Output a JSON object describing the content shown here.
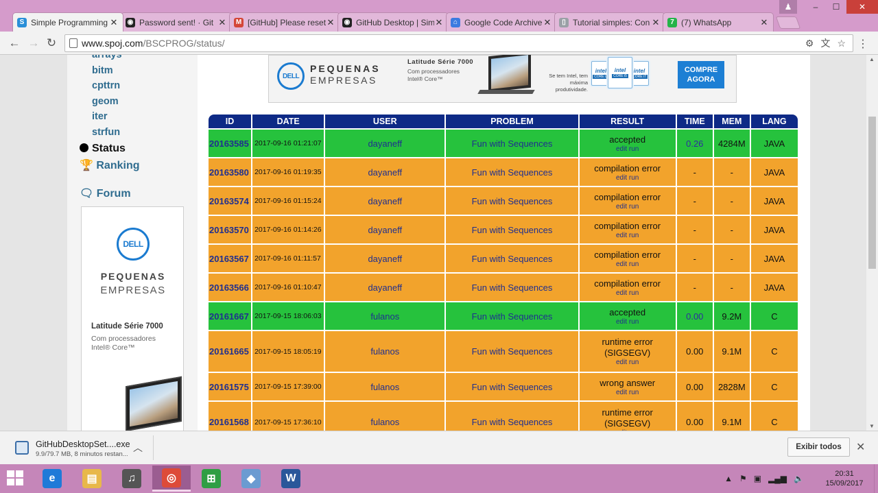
{
  "browser": {
    "tabs": [
      {
        "title": "Simple Programming",
        "icon": "spoj-icon",
        "color": "#2a8fd8",
        "glyph": "S",
        "active": true
      },
      {
        "title": "Password sent! · Git",
        "icon": "github-icon",
        "color": "#222222",
        "glyph": "◉",
        "active": false
      },
      {
        "title": "[GitHub] Please reset",
        "icon": "gmail-icon",
        "color": "#d44638",
        "glyph": "M",
        "active": false
      },
      {
        "title": "GitHub Desktop | Sim",
        "icon": "github-icon",
        "color": "#222222",
        "glyph": "◉",
        "active": false
      },
      {
        "title": "Google Code Archive",
        "icon": "google-code-icon",
        "color": "#3b7be0",
        "glyph": "⌂",
        "active": false
      },
      {
        "title": "Tutorial simples: Con",
        "icon": "page-icon",
        "color": "#9aa0a6",
        "glyph": "▯",
        "active": false
      },
      {
        "title": "(7) WhatsApp",
        "icon": "whatsapp-icon",
        "color": "#25b34a",
        "glyph": "7",
        "active": false
      }
    ],
    "url_host": "www.spoj.com",
    "url_path": "/BSCPROG/status/",
    "window_controls": {
      "minimize": "–",
      "maximize": "☐",
      "close": "✕",
      "user": "♟"
    }
  },
  "sidebar": {
    "links": [
      "arrays",
      "bitm",
      "cpttrn",
      "geom",
      "iter",
      "strfun"
    ],
    "status_label": "Status",
    "ranking_label": "Ranking",
    "forum_label": "Forum"
  },
  "ads": {
    "side": {
      "brand": "DELL",
      "line1": "PEQUENAS",
      "line2": "EMPRESAS",
      "model": "Latitude Série 7000",
      "processor": "Com processadores Intel® Core™"
    },
    "top": {
      "brand": "DELL",
      "line1": "PEQUENAS",
      "line2": "EMPRESAS",
      "model": "Latitude Série 7000",
      "processor": "Com processadores Intel® Core™",
      "intel_note": "Se tem Intel, tem máxima produtividade.",
      "chips": [
        {
          "brand": "intel",
          "core": "CORE i3"
        },
        {
          "brand": "intel",
          "core": "CORE i5"
        },
        {
          "brand": "intel",
          "core": "CORE i7"
        }
      ],
      "cta": "COMPRE AGORA"
    }
  },
  "table": {
    "headers": [
      "ID",
      "DATE",
      "USER",
      "PROBLEM",
      "RESULT",
      "TIME",
      "MEM",
      "LANG"
    ],
    "rows": [
      {
        "id": "20163585",
        "date": "2017-09-16 01:21:07",
        "user": "dayaneff",
        "problem": "Fun with Sequences",
        "result": "accepted",
        "links": "edit  run",
        "time": "0.26",
        "mem": "4284M",
        "lang": "JAVA",
        "status": "ok"
      },
      {
        "id": "20163580",
        "date": "2017-09-16 01:19:35",
        "user": "dayaneff",
        "problem": "Fun with Sequences",
        "result": "compilation error",
        "links": "edit  run",
        "time": "-",
        "mem": "-",
        "lang": "JAVA",
        "status": "bad"
      },
      {
        "id": "20163574",
        "date": "2017-09-16 01:15:24",
        "user": "dayaneff",
        "problem": "Fun with Sequences",
        "result": "compilation error",
        "links": "edit  run",
        "time": "-",
        "mem": "-",
        "lang": "JAVA",
        "status": "bad"
      },
      {
        "id": "20163570",
        "date": "2017-09-16 01:14:26",
        "user": "dayaneff",
        "problem": "Fun with Sequences",
        "result": "compilation error",
        "links": "edit  run",
        "time": "-",
        "mem": "-",
        "lang": "JAVA",
        "status": "bad"
      },
      {
        "id": "20163567",
        "date": "2017-09-16 01:11:57",
        "user": "dayaneff",
        "problem": "Fun with Sequences",
        "result": "compilation error",
        "links": "edit  run",
        "time": "-",
        "mem": "-",
        "lang": "JAVA",
        "status": "bad"
      },
      {
        "id": "20163566",
        "date": "2017-09-16 01:10:47",
        "user": "dayaneff",
        "problem": "Fun with Sequences",
        "result": "compilation error",
        "links": "edit  run",
        "time": "-",
        "mem": "-",
        "lang": "JAVA",
        "status": "bad"
      },
      {
        "id": "20161667",
        "date": "2017-09-15 18:06:03",
        "user": "fulanos",
        "problem": "Fun with Sequences",
        "result": "accepted",
        "links": "edit  run",
        "time": "0.00",
        "mem": "9.2M",
        "lang": "C",
        "status": "ok"
      },
      {
        "id": "20161665",
        "date": "2017-09-15 18:05:19",
        "user": "fulanos",
        "problem": "Fun with Sequences",
        "result": "runtime error (SIGSEGV)",
        "links": "edit  run",
        "time": "0.00",
        "mem": "9.1M",
        "lang": "C",
        "status": "bad"
      },
      {
        "id": "20161575",
        "date": "2017-09-15 17:39:00",
        "user": "fulanos",
        "problem": "Fun with Sequences",
        "result": "wrong answer",
        "links": "edit  run",
        "time": "0.00",
        "mem": "2828M",
        "lang": "C",
        "status": "bad"
      },
      {
        "id": "20161568",
        "date": "2017-09-15 17:36:10",
        "user": "fulanos",
        "problem": "Fun with Sequences",
        "result": "runtime error (SIGSEGV)",
        "links": "edit  run",
        "time": "0.00",
        "mem": "9.1M",
        "lang": "C",
        "status": "bad"
      }
    ]
  },
  "downloads": {
    "file_name": "GitHubDesktopSet....exe",
    "file_status": "9.9/79.7 MB, 8 minutos restan...",
    "show_all": "Exibir todos"
  },
  "taskbar": {
    "apps": [
      {
        "name": "internet-explorer",
        "glyph": "e",
        "color": "#1f7ad8"
      },
      {
        "name": "file-explorer",
        "glyph": "▤",
        "color": "#e8b84a"
      },
      {
        "name": "media-tool",
        "glyph": "♫",
        "color": "#555555"
      },
      {
        "name": "chrome",
        "glyph": "◎",
        "color": "#dd4b39"
      },
      {
        "name": "store",
        "glyph": "⊞",
        "color": "#2f9e44"
      },
      {
        "name": "virtualbox",
        "glyph": "◆",
        "color": "#6b9bd1"
      },
      {
        "name": "word",
        "glyph": "W",
        "color": "#2b579a"
      }
    ],
    "time": "20:31",
    "date": "15/09/2017"
  }
}
